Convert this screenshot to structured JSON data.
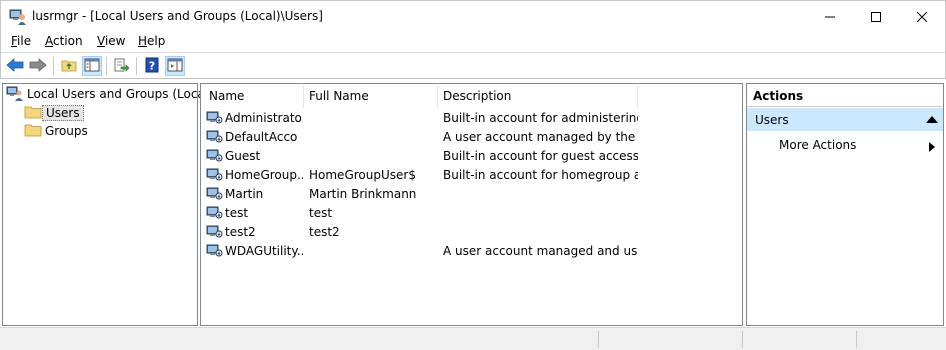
{
  "window": {
    "title": "lusrmgr - [Local Users and Groups (Local)\\Users]"
  },
  "menu": {
    "file": {
      "key": "F",
      "rest": "ile"
    },
    "action": {
      "key": "A",
      "rest": "ction"
    },
    "view": {
      "key": "V",
      "rest": "iew"
    },
    "help": {
      "key": "H",
      "rest": "elp"
    }
  },
  "toolbar": {
    "icons": [
      "back-arrow-icon",
      "forward-arrow-icon",
      "up-folder-icon",
      "show-tree-icon",
      "export-list-icon",
      "help-icon",
      "action-pane-icon"
    ]
  },
  "tree": {
    "root": "Local Users and Groups (Local)",
    "users": "Users",
    "groups": "Groups"
  },
  "list": {
    "columns": {
      "name": "Name",
      "full_name": "Full Name",
      "description": "Description"
    },
    "rows": [
      {
        "name": "Administrator",
        "full_name": "",
        "description": "Built-in account for administering..."
      },
      {
        "name": "DefaultAcco",
        "full_name": "",
        "description": "A user account managed by the s..."
      },
      {
        "name": "Guest",
        "full_name": "",
        "description": "Built-in account for guest access t..."
      },
      {
        "name": "HomeGroup...",
        "full_name": "HomeGroupUser$",
        "description": "Built-in account for homegroup a..."
      },
      {
        "name": "Martin",
        "full_name": "Martin Brinkmann",
        "description": ""
      },
      {
        "name": "test",
        "full_name": "test",
        "description": ""
      },
      {
        "name": "test2",
        "full_name": "test2",
        "description": ""
      },
      {
        "name": "WDAGUtility...",
        "full_name": "",
        "description": "A user account managed and use..."
      }
    ]
  },
  "actions": {
    "title": "Actions",
    "group": "Users",
    "more": "More Actions"
  },
  "colors": {
    "selection": "#cce8ff",
    "nav_arrow": "#2b7bd6",
    "folder": "#f5d77a",
    "help": "#1f4fb5"
  }
}
